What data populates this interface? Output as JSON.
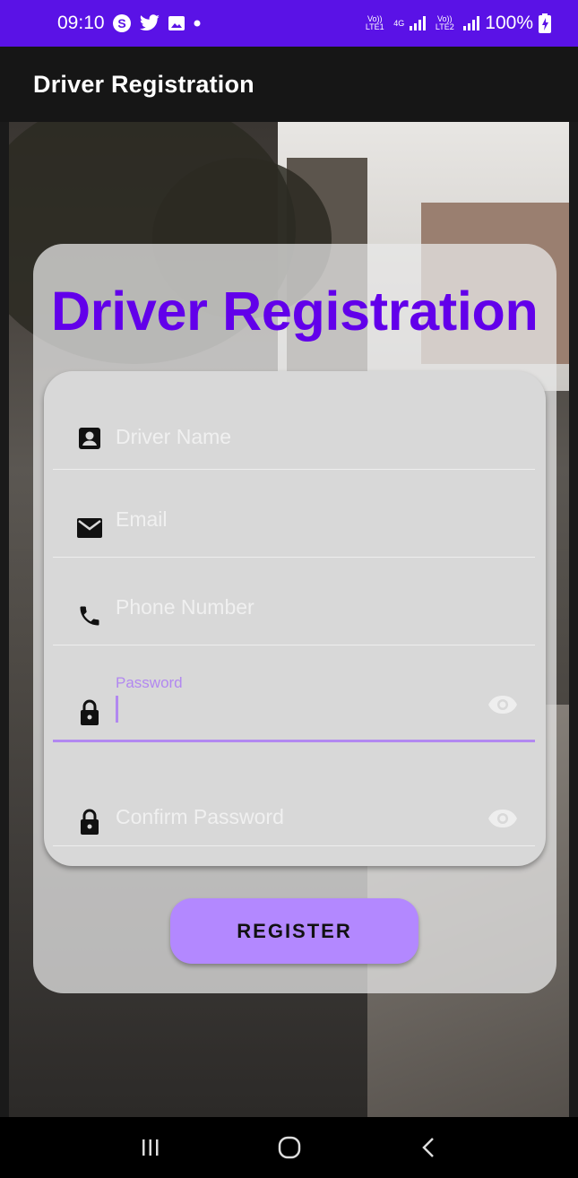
{
  "status_bar": {
    "time": "09:10",
    "battery": "100%",
    "network_label": "4G",
    "lte1": "Vo)) LTE1",
    "lte2": "Vo)) LTE2"
  },
  "app_bar": {
    "title": "Driver Registration"
  },
  "card": {
    "title": "Driver Registration"
  },
  "form": {
    "fields": [
      {
        "name": "driver-name",
        "placeholder": "Driver Name",
        "icon": "person-card-icon"
      },
      {
        "name": "email",
        "placeholder": "Email",
        "icon": "envelope-icon"
      },
      {
        "name": "phone",
        "placeholder": "Phone Number",
        "icon": "phone-icon"
      },
      {
        "name": "password",
        "label": "Password",
        "value": "",
        "icon": "lock-icon",
        "focused": true
      },
      {
        "name": "confirm-password",
        "placeholder": "Confirm Password",
        "icon": "lock-icon"
      }
    ]
  },
  "register_button": {
    "label": "REGISTER"
  },
  "colors": {
    "accent": "#6200ea",
    "button": "#b388ff",
    "status_bar": "#5a12e6",
    "focus": "#b288f0"
  }
}
